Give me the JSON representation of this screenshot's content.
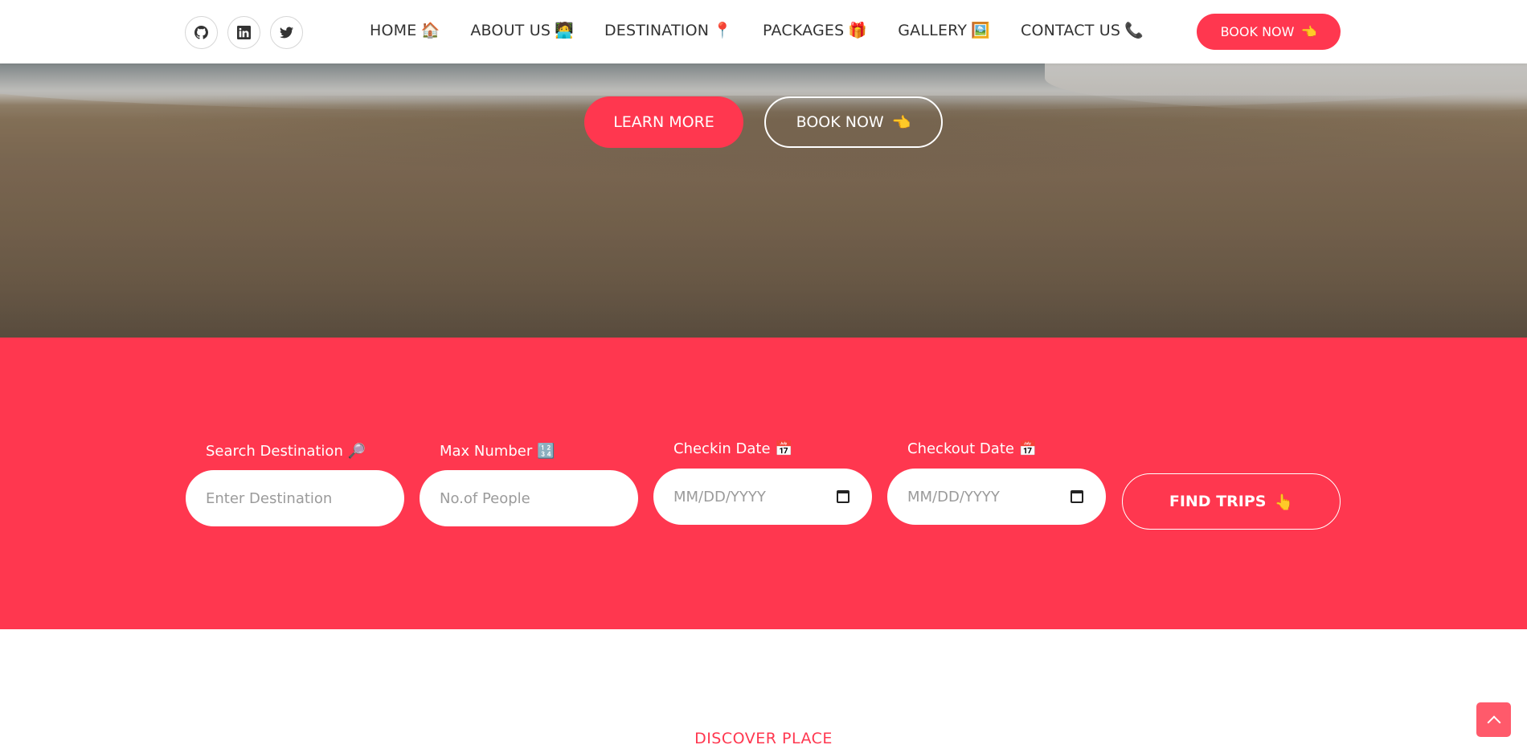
{
  "navbar": {
    "social": [
      {
        "icon": "github-icon",
        "label": "GitHub"
      },
      {
        "icon": "linkedin-icon",
        "label": "LinkedIn"
      },
      {
        "icon": "twitter-icon",
        "label": "Twitter"
      }
    ],
    "menu": [
      {
        "label": "HOME",
        "emoji": "🏠"
      },
      {
        "label": "ABOUT US",
        "emoji": "🧑‍💻"
      },
      {
        "label": "DESTINATION",
        "emoji": "📍"
      },
      {
        "label": "PACKAGES",
        "emoji": "🎁"
      },
      {
        "label": "GALLERY",
        "emoji": "🖼️"
      },
      {
        "label": "CONTACT US",
        "emoji": "📞"
      }
    ],
    "book_label": "BOOK NOW",
    "book_emoji": "👈"
  },
  "hero": {
    "learn_more": "LEARN MORE",
    "book_now": "BOOK NOW",
    "book_emoji": "👈"
  },
  "search": {
    "destination": {
      "label": "Search Destination 🔎",
      "placeholder": "Enter Destination"
    },
    "max_number": {
      "label": "Max Number 🔢",
      "placeholder": "No.of People"
    },
    "checkin": {
      "label": "Checkin Date 📅",
      "placeholder": "MM/DD/YYYY"
    },
    "checkout": {
      "label": "Checkout Date 📅",
      "placeholder": "MM/DD/YYYY"
    },
    "find_trips": "FIND TRIPS",
    "find_emoji": "👆"
  },
  "discover": "DISCOVER PLACE",
  "colors": {
    "accent": "#ff374f",
    "white": "#ffffff"
  }
}
